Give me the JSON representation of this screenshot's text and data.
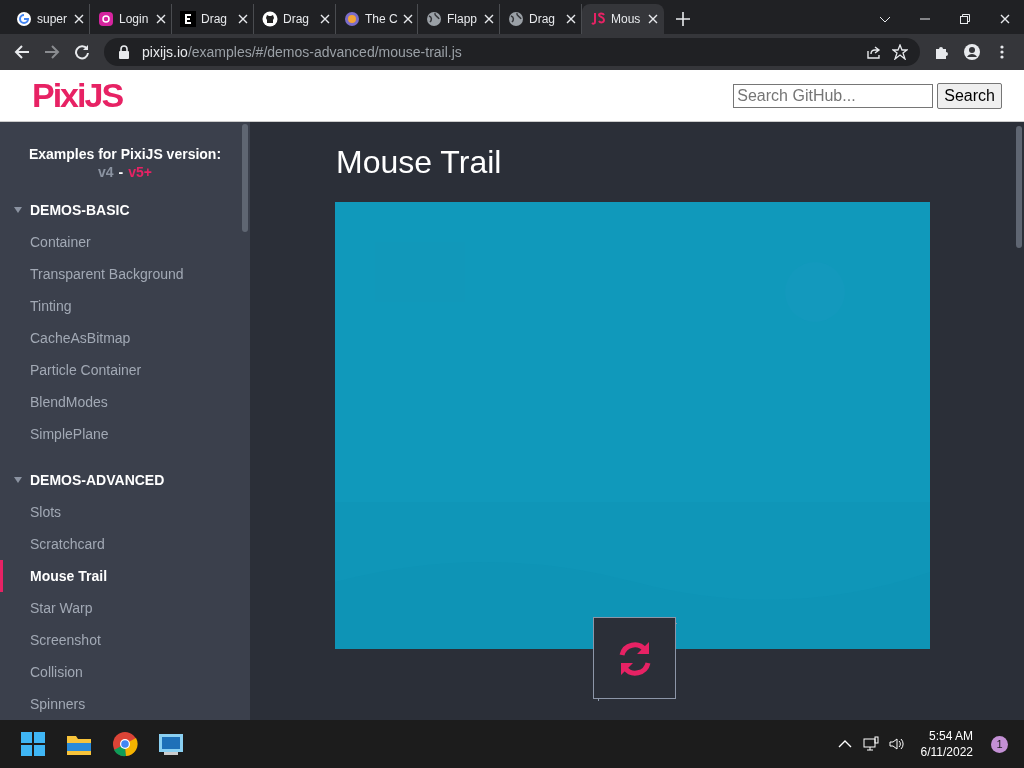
{
  "browser": {
    "tabs": [
      {
        "title": "super",
        "selected": false
      },
      {
        "title": "Login",
        "selected": false
      },
      {
        "title": "Drag",
        "selected": false
      },
      {
        "title": "Drag",
        "selected": false
      },
      {
        "title": "The C",
        "selected": false
      },
      {
        "title": "Flapp",
        "selected": false
      },
      {
        "title": "Drag",
        "selected": false
      },
      {
        "title": "Mous",
        "selected": true
      }
    ],
    "url": {
      "host": "pixijs.io",
      "path": "/examples/#/demos-advanced/mouse-trail.js"
    }
  },
  "header": {
    "logo": "PixiJS",
    "search": {
      "placeholder": "Search GitHub..."
    },
    "search_button": "Search"
  },
  "sidebar": {
    "heading": "Examples for PixiJS version:",
    "versions": [
      {
        "label": "v4",
        "selected": false
      },
      {
        "label": "v5+",
        "selected": true
      }
    ],
    "separator": "-",
    "groups": [
      {
        "title": "DEMOS-BASIC",
        "expanded": true,
        "items": [
          {
            "label": "Container",
            "selected": false
          },
          {
            "label": "Transparent Background",
            "selected": false
          },
          {
            "label": "Tinting",
            "selected": false
          },
          {
            "label": "CacheAsBitmap",
            "selected": false
          },
          {
            "label": "Particle Container",
            "selected": false
          },
          {
            "label": "BlendModes",
            "selected": false
          },
          {
            "label": "SimplePlane",
            "selected": false
          }
        ]
      },
      {
        "title": "DEMOS-ADVANCED",
        "expanded": true,
        "items": [
          {
            "label": "Slots",
            "selected": false
          },
          {
            "label": "Scratchcard",
            "selected": false
          },
          {
            "label": "Mouse Trail",
            "selected": true
          },
          {
            "label": "Star Warp",
            "selected": false
          },
          {
            "label": "Screenshot",
            "selected": false
          },
          {
            "label": "Collision",
            "selected": false
          },
          {
            "label": "Spinners",
            "selected": false
          }
        ]
      }
    ]
  },
  "main": {
    "title": "Mouse Trail"
  },
  "taskbar": {
    "time": "5:54 AM",
    "date": "6/11/2022",
    "notifications": "1"
  }
}
